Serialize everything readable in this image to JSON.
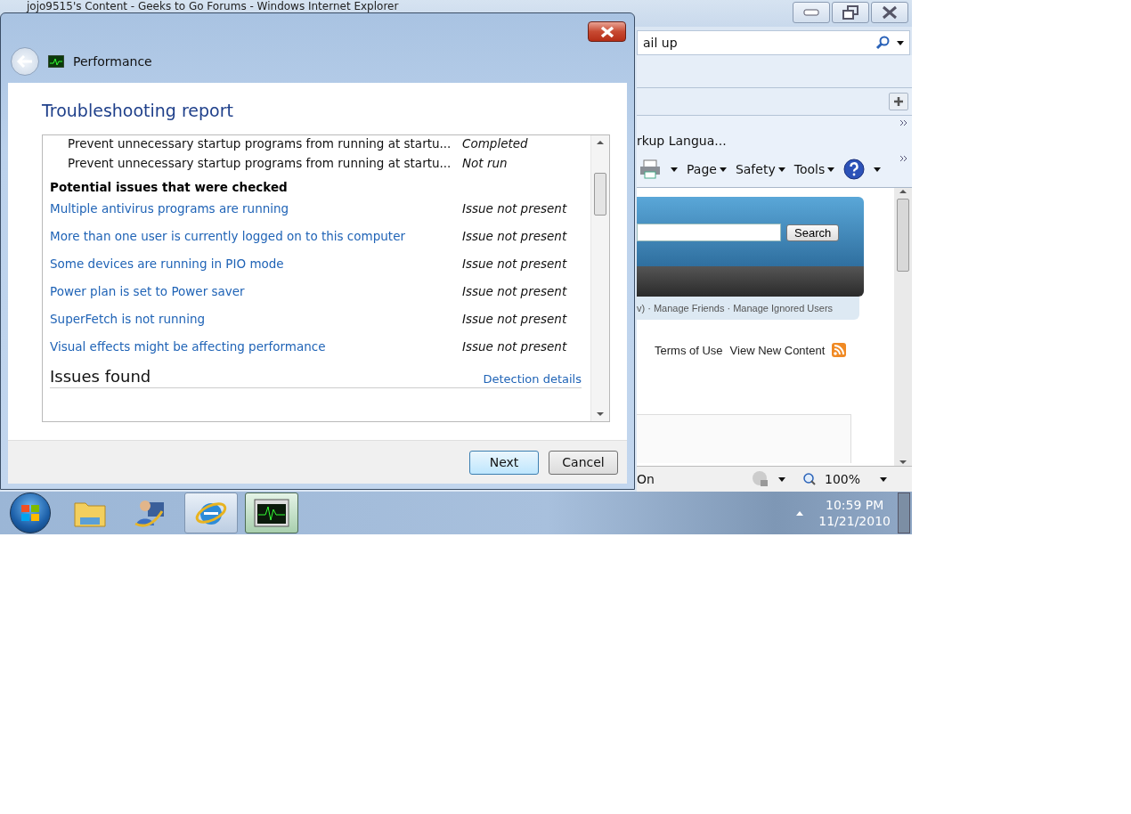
{
  "browser": {
    "title": "jojo9515's Content - Geeks to Go Forums - Windows Internet Explorer",
    "address": "ail up",
    "favorites_item": "rkup Langua...",
    "command_bar": [
      "Page",
      "Safety",
      "Tools"
    ],
    "page": {
      "search_button": "Search",
      "nav_links": "v) · Manage Friends · Manage Ignored Users",
      "footer_links": [
        "Terms of Use",
        "View New Content"
      ]
    },
    "status_bar": {
      "text": "On",
      "zoom": "100%"
    }
  },
  "dialog": {
    "title": "Performance",
    "heading": "Troubleshooting report",
    "checked_fixes": [
      {
        "name": "Prevent unnecessary startup programs from running at startu...",
        "status": "Completed"
      },
      {
        "name": "Prevent unnecessary startup programs from running at startu...",
        "status": "Not run"
      }
    ],
    "section_title": "Potential issues that were checked",
    "issues": [
      {
        "name": "Multiple antivirus programs are running",
        "status": "Issue not present"
      },
      {
        "name": "More than one user is currently logged on to this computer",
        "status": "Issue not present"
      },
      {
        "name": "Some devices are running in PIO mode",
        "status": "Issue not present"
      },
      {
        "name": "Power plan is set to Power saver",
        "status": "Issue not present"
      },
      {
        "name": "SuperFetch is not running",
        "status": "Issue not present"
      },
      {
        "name": "Visual effects might be affecting performance",
        "status": "Issue not present"
      }
    ],
    "footer_heading": "Issues found",
    "details_link": "Detection details",
    "buttons": [
      {
        "label": "Next",
        "default": true
      },
      {
        "label": "Cancel",
        "default": false
      }
    ]
  },
  "taskbar": {
    "apps": [
      {
        "kind": "folder",
        "running": false,
        "selected": false
      },
      {
        "kind": "user",
        "running": false,
        "selected": false
      },
      {
        "kind": "browser",
        "running": true,
        "selected": false
      },
      {
        "kind": "monitor",
        "running": true,
        "selected": true
      }
    ],
    "clock": {
      "time": "10:59 PM",
      "date": "11/21/2010"
    }
  }
}
